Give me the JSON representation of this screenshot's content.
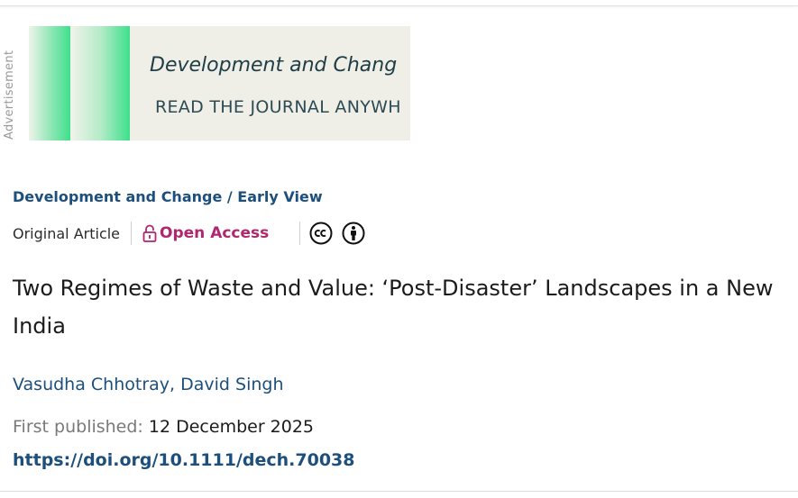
{
  "advertisement": {
    "label": "Advertisement",
    "banner_title": "Development and Chang",
    "banner_subtitle": "READ THE JOURNAL ANYWH"
  },
  "breadcrumb": {
    "journal": "Development and Change",
    "separator": " / ",
    "section": "Early View"
  },
  "meta": {
    "article_type": "Original Article",
    "open_access_label": "Open Access",
    "lock_icon": "open-lock-icon",
    "license_icons": [
      "creative-commons-icon",
      "attribution-icon"
    ]
  },
  "article": {
    "title": "Two Regimes of Waste and Value: ‘Post-Disaster’ Landscapes in a New India",
    "authors": [
      "Vasudha Chhotray",
      "David Singh"
    ],
    "author_separator": ", ",
    "first_published_label": "First published:",
    "first_published_date": "12 December 2025",
    "doi": "https://doi.org/10.1111/dech.70038"
  },
  "colors": {
    "link": "#1d4f7c",
    "open_access": "#b2256f",
    "ad_accent": "#3de08b"
  }
}
